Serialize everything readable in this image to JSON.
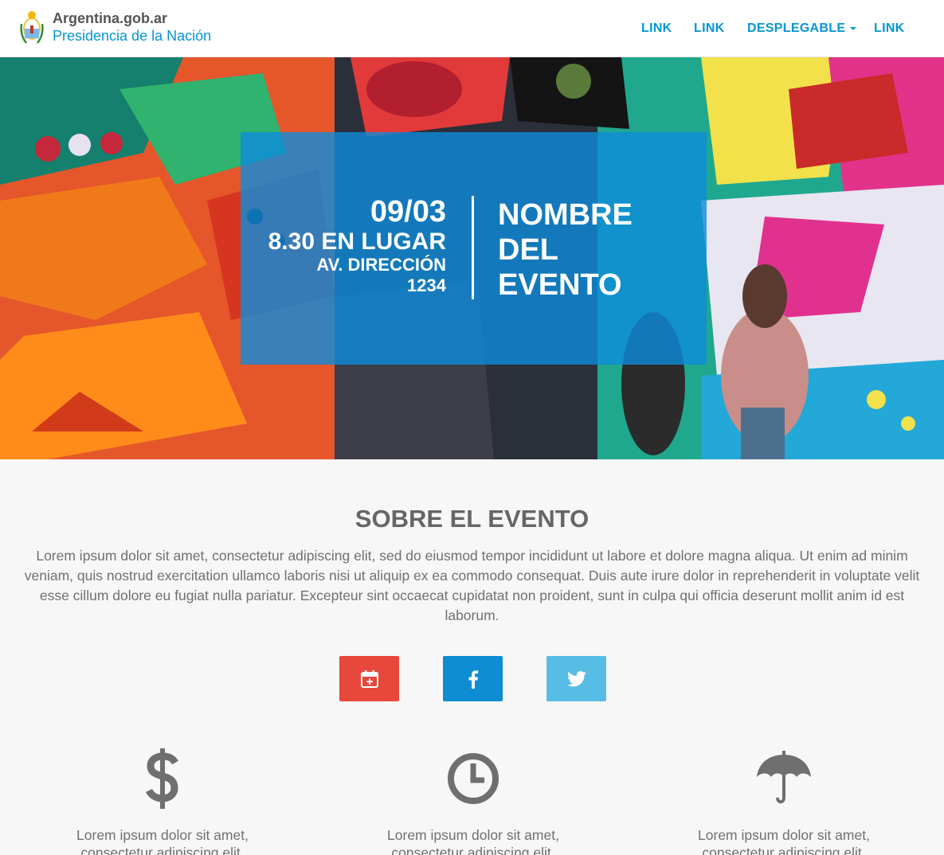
{
  "header": {
    "brand_title": "Argentina.gob.ar",
    "brand_subtitle": "Presidencia de la Nación",
    "nav": [
      {
        "label": "LINK"
      },
      {
        "label": "LINK"
      },
      {
        "label": "DESPLEGABLE"
      },
      {
        "label": "LINK"
      }
    ]
  },
  "hero": {
    "date": "09/03",
    "time_place": "8.30 EN LUGAR",
    "address_line1": "AV. DIRECCIÓN",
    "address_line2": "1234",
    "event_name_line1": "NOMBRE",
    "event_name_line2": "DEL",
    "event_name_line3": "EVENTO"
  },
  "about": {
    "title": "SOBRE EL EVENTO",
    "text": "Lorem ipsum dolor sit amet, consectetur adipiscing elit, sed do eiusmod tempor incididunt ut labore et dolore magna aliqua. Ut enim ad minim veniam, quis nostrud exercitation ullamco laboris nisi ut aliquip ex ea commodo consequat. Duis aute irure dolor in reprehenderit in voluptate velit esse cillum dolore eu fugiat nulla pariatur. Excepteur sint occaecat cupidatat non proident, sunt in culpa qui officia deserunt mollit anim id est laborum."
  },
  "share": [
    {
      "icon": "calendar-add-icon",
      "color": "#e8473c"
    },
    {
      "icon": "facebook-icon",
      "color": "#0e8cd4"
    },
    {
      "icon": "twitter-icon",
      "color": "#58bde5"
    }
  ],
  "features": [
    {
      "icon": "dollar-icon",
      "text": "Lorem ipsum dolor sit amet, consectetur adipiscing elit."
    },
    {
      "icon": "clock-icon",
      "text": "Lorem ipsum dolor sit amet, consectetur adipiscing elit."
    },
    {
      "icon": "umbrella-icon",
      "text": "Lorem ipsum dolor sit amet, consectetur adipiscing elit."
    }
  ],
  "colors": {
    "brand_blue": "#0695d6",
    "hero_overlay": "#0e8cdc",
    "background": "#f7f7f7"
  }
}
